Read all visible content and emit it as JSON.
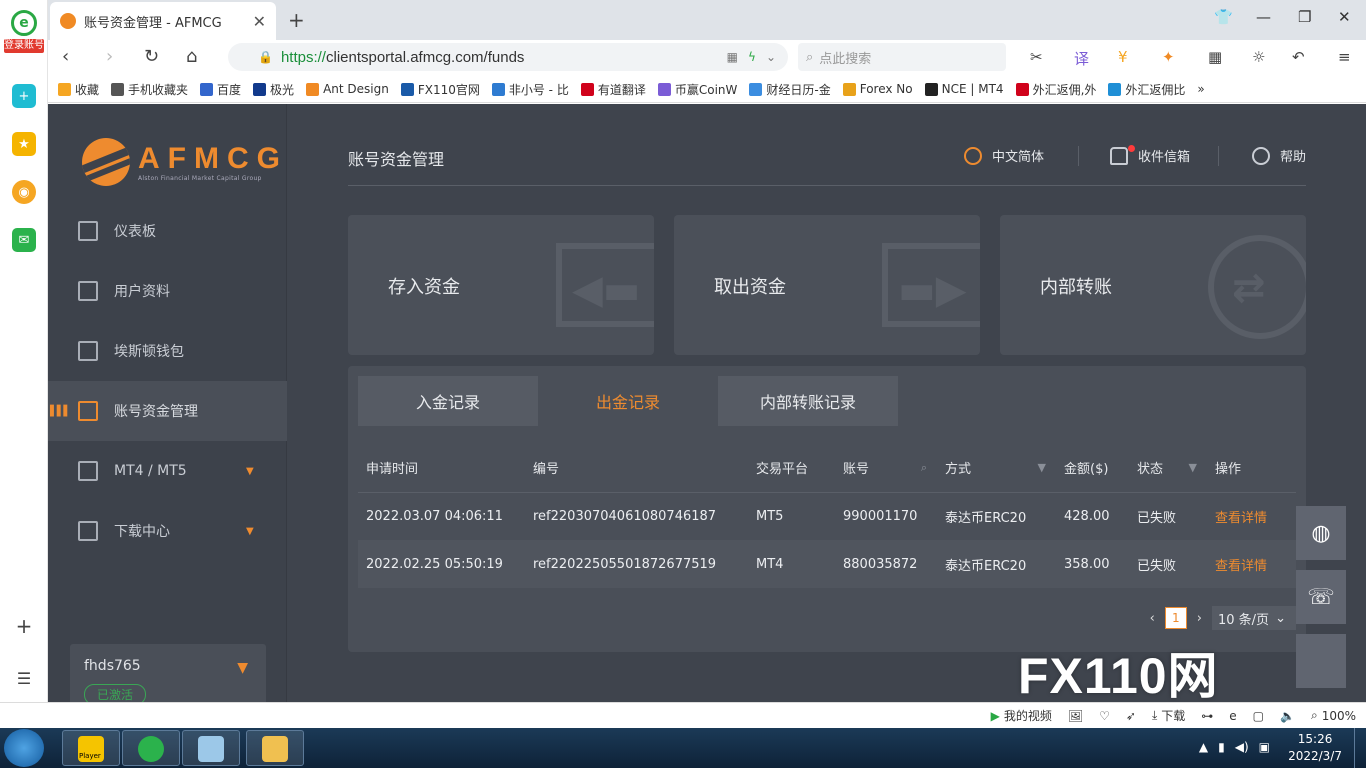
{
  "browser": {
    "login_label": "登录账号",
    "tab_title": "账号资金管理 - AFMCG",
    "url_scheme": "https://",
    "url_rest": "clientsportal.afmcg.com/funds",
    "search_placeholder": "点此搜索",
    "bookmarks": [
      "收藏",
      "手机收藏夹",
      "百度",
      "极光",
      "Ant Design",
      "FX110官网",
      "非小号 - 比",
      "有道翻译",
      "币赢CoinW",
      "财经日历-金",
      "Forex No",
      "NCE | MT4",
      "外汇返佣,外",
      "外汇返佣比"
    ],
    "bookmark_colors": [
      "#f5a623",
      "#555555",
      "#3366cc",
      "#123a8c",
      "#f08a24",
      "#1a5aa8",
      "#2e7bd1",
      "#d0021b",
      "#7b5cd6",
      "#3b8de0",
      "#e8a21a",
      "#222222",
      "#d0021b",
      "#1f8fd6"
    ]
  },
  "sidebar": {
    "logo_text": "AFMCG",
    "logo_sub": "Alston Financial Market Capital Group",
    "items": [
      {
        "label": "仪表板"
      },
      {
        "label": "用户资料"
      },
      {
        "label": "埃斯顿钱包"
      },
      {
        "label": "账号资金管理"
      },
      {
        "label": "MT4 / MT5"
      },
      {
        "label": "下载中心"
      }
    ],
    "user_name": "fhds765",
    "user_status": "已激活"
  },
  "header": {
    "title": "账号资金管理",
    "language": "中文简体",
    "inbox": "收件信箱",
    "help": "帮助"
  },
  "cards": [
    {
      "label": "存入资金"
    },
    {
      "label": "取出资金"
    },
    {
      "label": "内部转账"
    }
  ],
  "records": {
    "tabs": [
      "入金记录",
      "出金记录",
      "内部转账记录"
    ],
    "columns": [
      "申请时间",
      "编号",
      "交易平台",
      "账号",
      "方式",
      "金额($)",
      "状态",
      "操作"
    ],
    "rows": [
      [
        "2022.03.07 04:06:11",
        "ref22030704061080746187",
        "MT5",
        "990001170",
        "泰达币ERC20",
        "428.00",
        "已失败",
        "查看详情"
      ],
      [
        "2022.02.25 05:50:19",
        "ref22022505501872677519",
        "MT4",
        "880035872",
        "泰达币ERC20",
        "358.00",
        "已失败",
        "查看详情"
      ]
    ],
    "current_page": "1",
    "page_size": "10 条/页"
  },
  "watermark": "FX110网",
  "statusbar": {
    "video": "我的视频",
    "download": "下载",
    "zoom": "100%"
  },
  "taskbar": {
    "player_label": "Player",
    "time": "15:26",
    "date": "2022/3/7"
  },
  "colors": {
    "accent": "#ee8b2f",
    "bg": "#3f444d",
    "success": "#3aa655"
  }
}
